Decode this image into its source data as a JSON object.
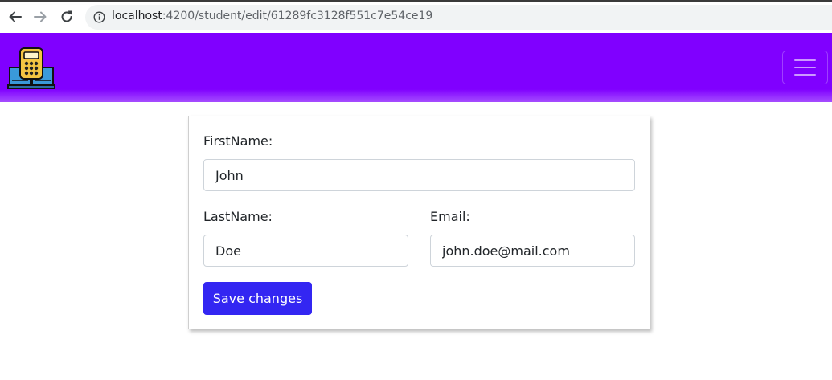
{
  "browser": {
    "url_host": "localhost",
    "url_path": ":4200/student/edit/61289fc3128f551c7e54ce19",
    "icons": [
      "back-arrow-icon",
      "forward-arrow-icon",
      "reload-icon",
      "info-icon"
    ]
  },
  "navbar": {
    "logo_icon": "calculator-book-icon",
    "toggler_icon": "hamburger-menu-icon",
    "colors": {
      "background": "#8000ff"
    }
  },
  "form": {
    "first_name_label": "FirstName:",
    "first_name_value": "John",
    "last_name_label": "LastName:",
    "last_name_value": "Doe",
    "email_label": "Email:",
    "email_value": "john.doe@mail.com",
    "save_label": "Save changes",
    "colors": {
      "button": "#3326f2"
    }
  }
}
